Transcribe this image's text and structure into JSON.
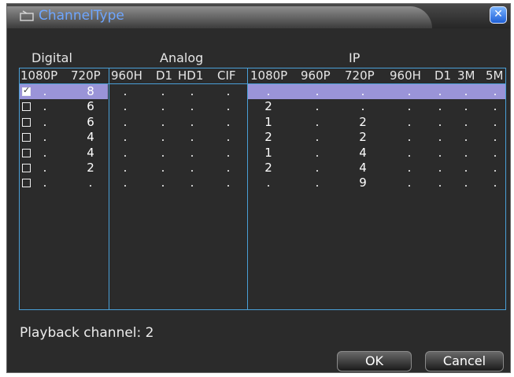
{
  "window": {
    "title": "ChannelType"
  },
  "groups": {
    "digital": "Digital",
    "analog": "Analog",
    "ip": "IP"
  },
  "columns": [
    "1080P",
    "720P",
    "960H",
    "D1",
    "HD1",
    "CIF",
    "1080P",
    "960P",
    "720P",
    "960H",
    "D1",
    "3M",
    "5M"
  ],
  "rows": [
    {
      "checked": true,
      "cells": [
        ".",
        "8",
        ".",
        ".",
        ".",
        ".",
        ".",
        ".",
        ".",
        ".",
        ".",
        ".",
        "."
      ]
    },
    {
      "checked": false,
      "cells": [
        ".",
        "6",
        ".",
        ".",
        ".",
        ".",
        "2",
        ".",
        ".",
        ".",
        ".",
        ".",
        "."
      ]
    },
    {
      "checked": false,
      "cells": [
        ".",
        "6",
        ".",
        ".",
        ".",
        ".",
        "1",
        ".",
        "2",
        ".",
        ".",
        ".",
        "."
      ]
    },
    {
      "checked": false,
      "cells": [
        ".",
        "4",
        ".",
        ".",
        ".",
        ".",
        "2",
        ".",
        "2",
        ".",
        ".",
        ".",
        "."
      ]
    },
    {
      "checked": false,
      "cells": [
        ".",
        "4",
        ".",
        ".",
        ".",
        ".",
        "1",
        ".",
        "4",
        ".",
        ".",
        ".",
        "."
      ]
    },
    {
      "checked": false,
      "cells": [
        ".",
        "2",
        ".",
        ".",
        ".",
        ".",
        "2",
        ".",
        "4",
        ".",
        ".",
        ".",
        "."
      ]
    },
    {
      "checked": false,
      "cells": [
        ".",
        ".",
        ".",
        ".",
        ".",
        ".",
        ".",
        ".",
        "9",
        ".",
        ".",
        ".",
        "."
      ]
    }
  ],
  "playback": "Playback channel: 2",
  "buttons": {
    "ok": "OK",
    "cancel": "Cancel"
  },
  "colors": {
    "title": "#6ea6ff",
    "grid": "#4aa0d8",
    "selection": "#9a94d8"
  }
}
